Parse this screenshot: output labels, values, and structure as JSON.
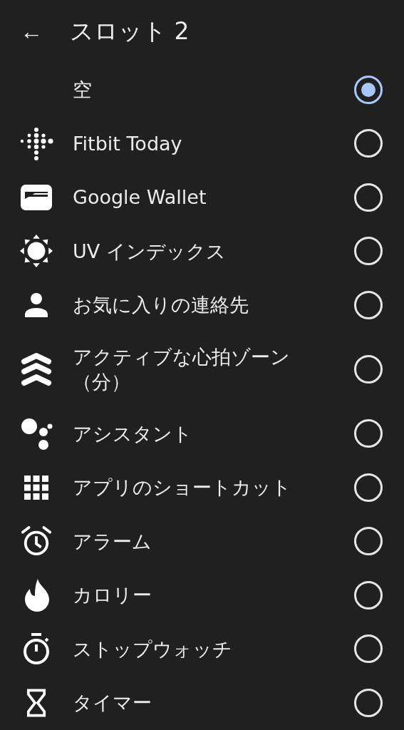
{
  "header": {
    "back": "←",
    "title": "スロット 2"
  },
  "options": [
    {
      "label": "空",
      "selected": true
    },
    {
      "label": "Fitbit Today",
      "selected": false
    },
    {
      "label": "Google Wallet",
      "selected": false
    },
    {
      "label": "UV インデックス",
      "selected": false
    },
    {
      "label": "お気に入りの連絡先",
      "selected": false
    },
    {
      "label": "アクティブな心拍ゾーン（分）",
      "selected": false
    },
    {
      "label": "アシスタント",
      "selected": false
    },
    {
      "label": "アプリのショートカット",
      "selected": false
    },
    {
      "label": "アラーム",
      "selected": false
    },
    {
      "label": "カロリー",
      "selected": false
    },
    {
      "label": "ストップウォッチ",
      "selected": false
    },
    {
      "label": "タイマー",
      "selected": false
    }
  ]
}
